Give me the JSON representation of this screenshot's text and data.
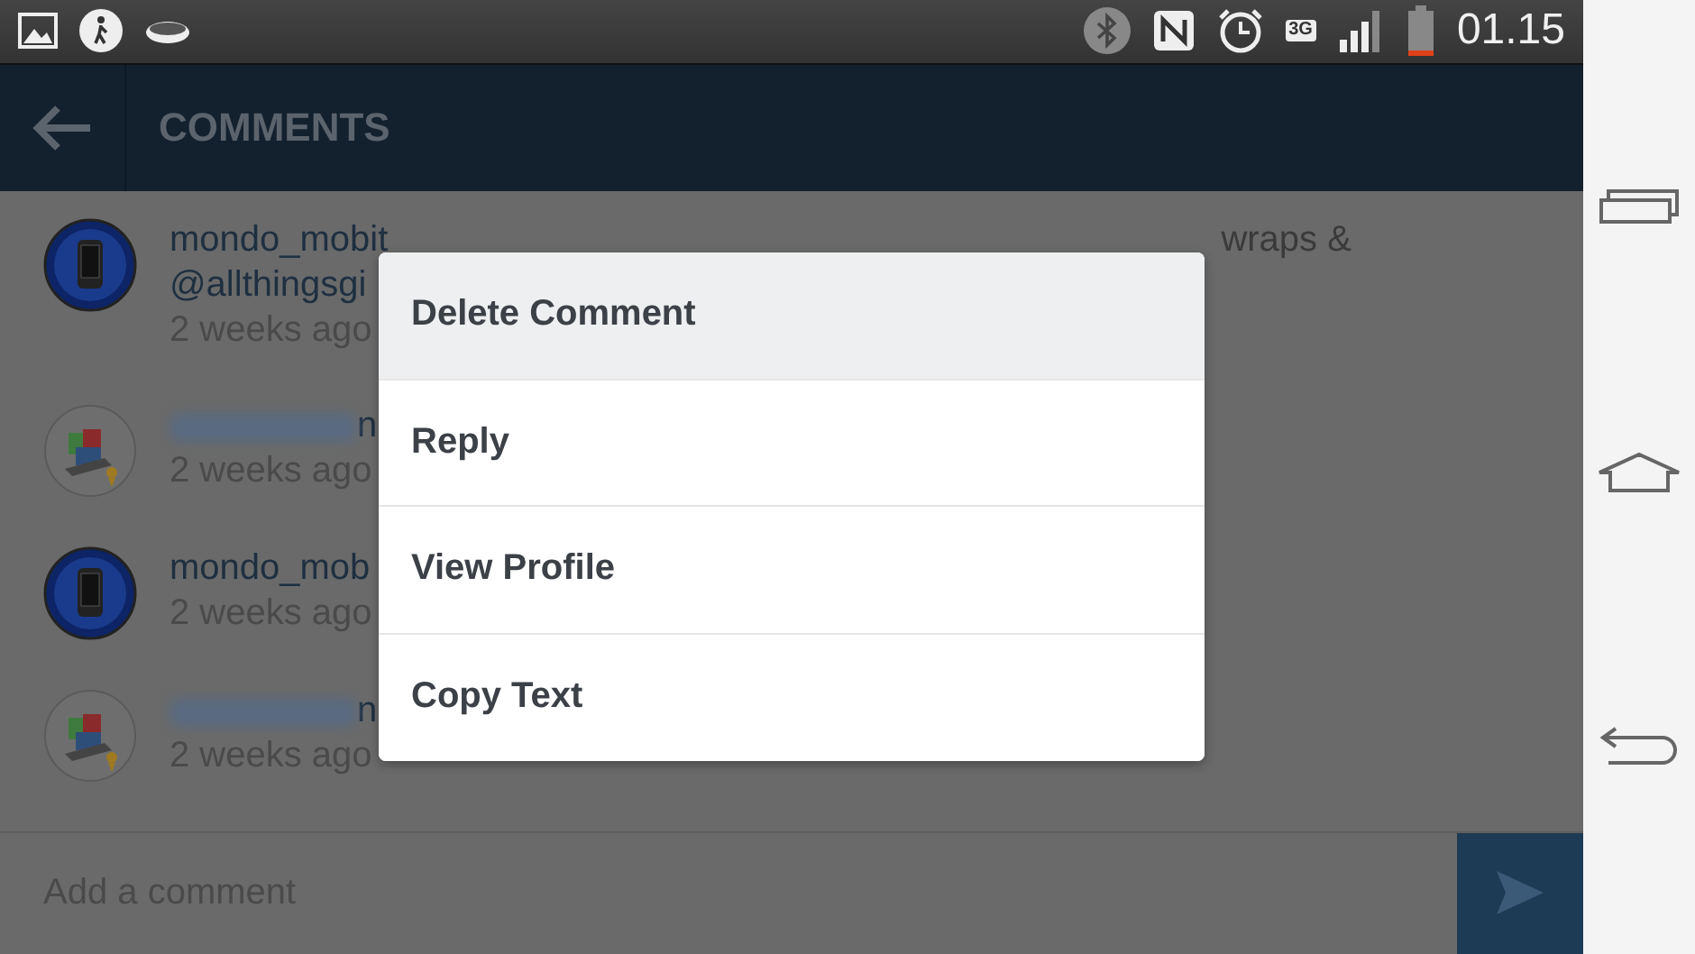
{
  "status_bar": {
    "network": "3G",
    "time": "01.15"
  },
  "header": {
    "title": "COMMENTS"
  },
  "comments": [
    {
      "avatar": {
        "kind": "phone"
      },
      "name": "mondo_mobit",
      "name_blurred": false,
      "line_2": "@allthingsgi",
      "trailing": "wraps &",
      "time": "2 weeks ago"
    },
    {
      "avatar": {
        "kind": "gadget"
      },
      "name": "n",
      "name_blurred": true,
      "time": "2 weeks ago"
    },
    {
      "avatar": {
        "kind": "phone"
      },
      "name": "mondo_mob",
      "name_blurred": false,
      "time": "2 weeks ago"
    },
    {
      "avatar": {
        "kind": "gadget"
      },
      "name": "n",
      "name_blurred": true,
      "time": "2 weeks ago"
    }
  ],
  "menu": [
    {
      "label": "Delete Comment",
      "selected": true
    },
    {
      "label": "Reply",
      "selected": false
    },
    {
      "label": "View Profile",
      "selected": false
    },
    {
      "label": "Copy Text",
      "selected": false
    }
  ],
  "composer": {
    "placeholder": "Add a comment"
  }
}
